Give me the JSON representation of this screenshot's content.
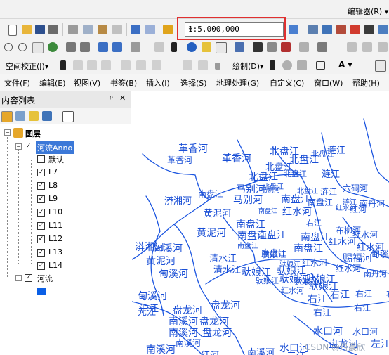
{
  "editor_label": "编辑器(R) ▾",
  "scale": {
    "value": "1:5,000,000"
  },
  "toolbar": {
    "georef_label": "空间校正(J)▾",
    "draw_label": "绘制(D)▾",
    "text_tool": "A ▾"
  },
  "menu": [
    "文件(F)",
    "编辑(E)",
    "视图(V)",
    "书签(B)",
    "插入(I)",
    "选择(S)",
    "地理处理(G)",
    "自定义(C)",
    "窗口(W)",
    "帮助(H)"
  ],
  "toc": {
    "title": "内容列表",
    "pin": "ᵖ",
    "close": "✕",
    "layers_root": "图层",
    "anno_group": "河流Anno",
    "default_class": "默认",
    "classes": [
      "L7",
      "L8",
      "L9",
      "L10",
      "L11",
      "L12",
      "L13",
      "L14"
    ],
    "river_layer": "河流",
    "river_symbol_color": "#0a5fe6"
  },
  "map": {
    "label_color": "#1a4fd6",
    "river_color": "#1b55e0",
    "labels": [
      "革香河",
      "北盘江",
      "涟江",
      "革香河",
      "革香河",
      "北盘江",
      "北盘江",
      "北盘江",
      "北盘江",
      "马别河",
      "涟江",
      "北盘江",
      "北盘江",
      "涟江",
      "六硐河",
      "马别河",
      "南盘江",
      "马别河",
      "南盘江",
      "南盘江",
      "北盘江",
      "涟江",
      "漭湘河",
      "黄泥河",
      "南盘江",
      "南盘江",
      "红水河",
      "红水河",
      "南丹河",
      "黄泥河",
      "南盘江",
      "南盘江",
      "南盘江",
      "布柳河",
      "甸溪河",
      "黄泥河",
      "南盘江",
      "南盘江",
      "红水河",
      "红水河",
      "甸溪河",
      "清水江",
      "驮娘江",
      "驮娘江",
      "赐福河",
      "甸溪河",
      "清水江",
      "驮娘江",
      "驮娘江",
      "红水河",
      "红水河",
      "驮娘江",
      "驮娘江",
      "红水河",
      "甸溪河",
      "驮娘江",
      "驮娘江",
      "驮娘江",
      "右江",
      "沪江",
      "盘龙河",
      "右江",
      "右江",
      "元江",
      "盘龙河",
      "右江",
      "右江",
      "南溪河",
      "盘龙河",
      "南溪河",
      "盘龙河",
      "水口河",
      "水口河",
      "南溪河",
      "盘龙河",
      "水口河",
      "左江",
      "南溪河",
      "红河",
      "南溪河",
      "漭湘河",
      "红河",
      "元江",
      "右江",
      "红水河",
      "南盘江",
      "南丹河",
      "右江"
    ],
    "watermark": "CSDN @丹晨欣"
  }
}
